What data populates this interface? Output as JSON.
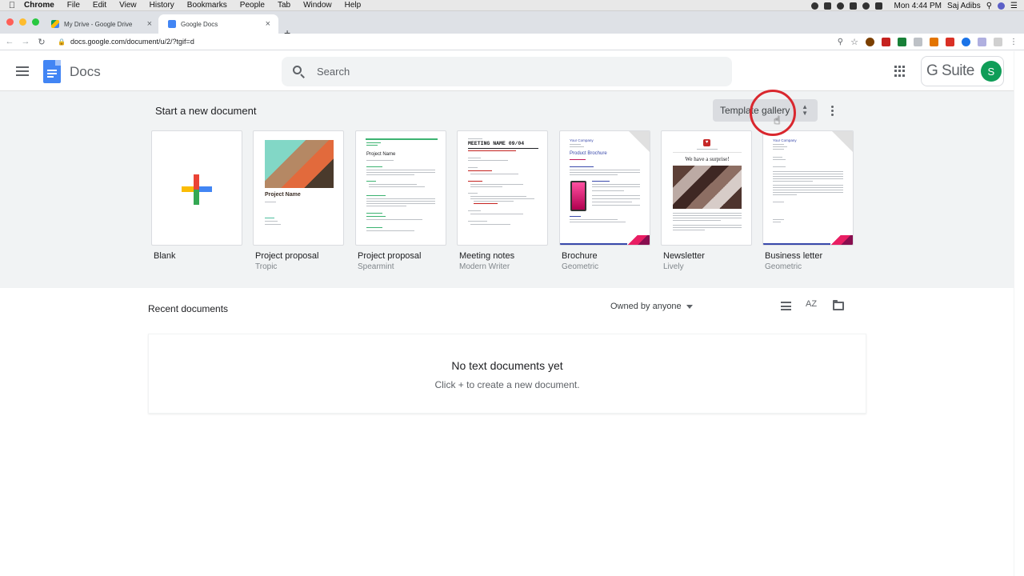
{
  "macos_menu": {
    "app_name": "Chrome",
    "items": [
      "File",
      "Edit",
      "View",
      "History",
      "Bookmarks",
      "People",
      "Tab",
      "Window",
      "Help"
    ],
    "clock": "Mon 4:44 PM",
    "user": "Saj Adibs"
  },
  "browser": {
    "tabs": [
      {
        "title": "My Drive - Google Drive",
        "icon": "google-drive-icon"
      },
      {
        "title": "Google Docs",
        "icon": "google-docs-icon"
      }
    ],
    "url": "docs.google.com/document/u/2/?tgif=d"
  },
  "header": {
    "app_title": "Docs",
    "search_placeholder": "Search",
    "gsuite_label": "G Suite",
    "avatar_letter": "S"
  },
  "templates_section": {
    "title": "Start a new document",
    "gallery_button": "Template gallery",
    "templates": [
      {
        "name": "Blank",
        "subtitle": ""
      },
      {
        "name": "Project proposal",
        "subtitle": "Tropic"
      },
      {
        "name": "Project proposal",
        "subtitle": "Spearmint"
      },
      {
        "name": "Meeting notes",
        "subtitle": "Modern Writer"
      },
      {
        "name": "Brochure",
        "subtitle": "Geometric"
      },
      {
        "name": "Newsletter",
        "subtitle": "Lively"
      },
      {
        "name": "Business letter",
        "subtitle": "Geometric"
      }
    ],
    "thumb_text": {
      "tropic_title": "Project Name",
      "spearmint_title": "Project Name",
      "meeting_title": "MEETING NAME 09/04",
      "brochure_company": "Your Company",
      "brochure_title": "Product Brochure",
      "newsletter_title": "We have a surprise!",
      "letter_company": "Your Company"
    }
  },
  "recent": {
    "title": "Recent documents",
    "owner_filter": "Owned by anyone",
    "sort_label": "AZ",
    "empty_title": "No text documents yet",
    "empty_subtitle": "Click + to create a new document."
  },
  "colors": {
    "docs_blue": "#4285f4",
    "highlight_red": "#d9272e",
    "avatar_green": "#0f9d58"
  }
}
